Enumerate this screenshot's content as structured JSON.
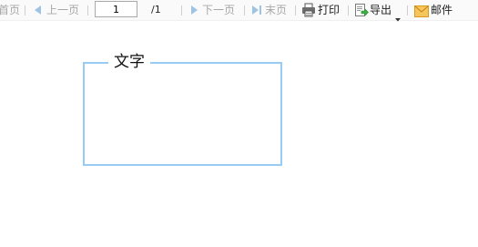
{
  "toolbar": {
    "first_page_label": "首页",
    "prev_page_label": "上一页",
    "page_input_value": "1",
    "page_total": "/1",
    "next_page_label": "下一页",
    "last_page_label": "末页",
    "print_label": "打印",
    "export_label": "导出",
    "mail_label": "邮件",
    "icons": [
      "prev-arrow-icon",
      "next-arrow-icon",
      "last-page-icon",
      "printer-icon",
      "export-icon",
      "dropdown-caret-icon",
      "mail-icon"
    ],
    "colors": {
      "disabled_text": "#a8a8a8",
      "enabled_text": "#222222",
      "nav_arrow": "#9ec3e3"
    }
  },
  "content": {
    "groupbox_legend": "文字",
    "groupbox_border_color": "#99ccf5"
  }
}
